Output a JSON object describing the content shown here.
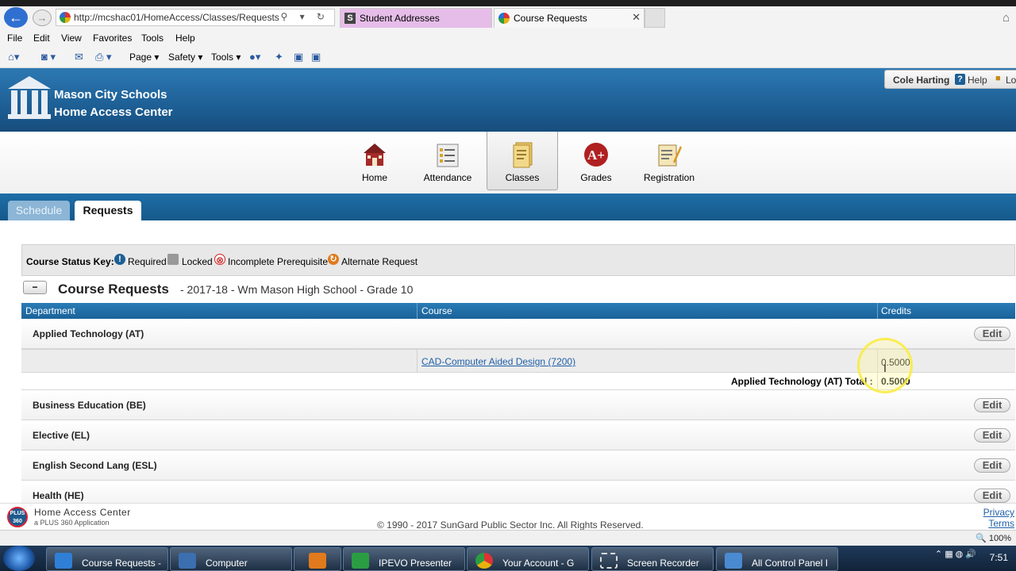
{
  "browser": {
    "url": "http://mcshac01/HomeAccess/Classes/Requests",
    "url_icons": "⚲ ▾ ↻",
    "tabs": [
      {
        "title": "Student Addresses",
        "icon": "S"
      },
      {
        "title": "Course Requests",
        "close": "✕"
      }
    ],
    "menu": [
      "File",
      "Edit",
      "View",
      "Favorites",
      "Tools",
      "Help"
    ],
    "commands": [
      "Page ▾",
      "Safety ▾",
      "Tools ▾"
    ]
  },
  "header": {
    "org_line1": "Mason City Schools",
    "org_line2": "Home Access Center",
    "user": "Cole Harting",
    "help": "Help",
    "logout": "Lo"
  },
  "nav": [
    {
      "label": "Home",
      "icon": "home-icon"
    },
    {
      "label": "Attendance",
      "icon": "attendance-icon"
    },
    {
      "label": "Classes",
      "icon": "classes-icon",
      "active": true
    },
    {
      "label": "Grades",
      "icon": "grades-icon"
    },
    {
      "label": "Registration",
      "icon": "registration-icon"
    }
  ],
  "subtabs": {
    "schedule": "Schedule",
    "requests": "Requests"
  },
  "status_key": {
    "label": "Course Status Key:",
    "required": "Required",
    "locked": "Locked",
    "incomplete": "Incomplete Prerequisite",
    "alternate": "Alternate Request",
    "required_glyph": "!",
    "incomplete_glyph": "⊗",
    "alternate_glyph": "↻"
  },
  "requests": {
    "collapse": "−",
    "title": "Course Requests",
    "subtitle": "- 2017-18 - Wm Mason High School - Grade 10"
  },
  "grid": {
    "columns": [
      "Department",
      "Course",
      "Credits"
    ],
    "edit_label": "Edit",
    "departments": [
      "Applied Technology (AT)",
      "Business Education (BE)",
      "Elective (EL)",
      "English Second Lang (ESL)",
      "Health (HE)"
    ],
    "course": {
      "name": "CAD-Computer Aided Design (7200)",
      "credits": "0.5000"
    },
    "total": {
      "label": "Applied Technology (AT) Total :",
      "value": "0.5000"
    }
  },
  "footer": {
    "product": "Home Access Center",
    "tagline": "a PLUS 360 Application",
    "badge": "PLUS 360",
    "copyright": "© 1990 - 2017 SunGard Public Sector Inc. All Rights Reserved.",
    "privacy": "Privacy",
    "terms": "Terms"
  },
  "statusbar": {
    "zoom": "🔍 100%"
  },
  "taskbar": {
    "items": [
      "Course Requests -",
      "Computer",
      "",
      "IPEVO Presenter",
      "Your Account - G",
      "Screen Recorder",
      "All Control Panel I"
    ],
    "clock": "7:51"
  },
  "colors": {
    "header_blue": "#1d5f95",
    "link": "#1f5fa8"
  }
}
